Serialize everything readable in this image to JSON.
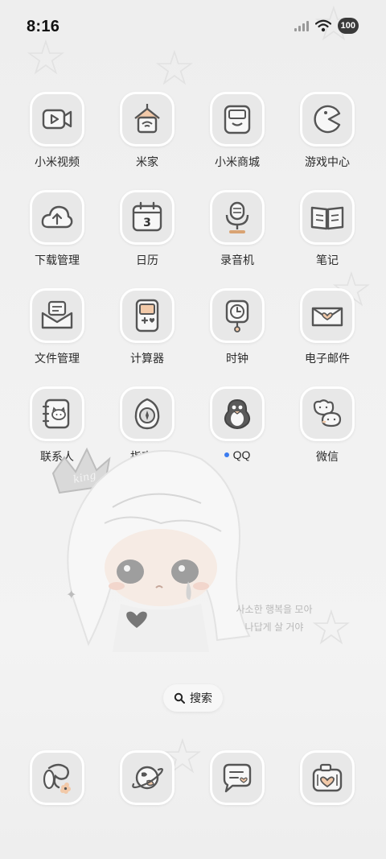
{
  "status_bar": {
    "time": "8:16",
    "battery": "100"
  },
  "apps": [
    {
      "label": "小米视频",
      "icon": "video-camera-icon",
      "name": "xiaomi-video"
    },
    {
      "label": "米家",
      "icon": "smart-home-icon",
      "name": "mijia"
    },
    {
      "label": "小米商城",
      "icon": "shopping-bag-icon",
      "name": "xiaomi-mall"
    },
    {
      "label": "游戏中心",
      "icon": "pacman-icon",
      "name": "game-center"
    },
    {
      "label": "下载管理",
      "icon": "cloud-download-icon",
      "name": "download-manager"
    },
    {
      "label": "日历",
      "icon": "calendar-icon",
      "name": "calendar"
    },
    {
      "label": "录音机",
      "icon": "microphone-icon",
      "name": "recorder"
    },
    {
      "label": "笔记",
      "icon": "notebook-icon",
      "name": "notes"
    },
    {
      "label": "文件管理",
      "icon": "envelope-file-icon",
      "name": "file-manager"
    },
    {
      "label": "计算器",
      "icon": "game-console-icon",
      "name": "calculator"
    },
    {
      "label": "时钟",
      "icon": "clock-icon",
      "name": "clock"
    },
    {
      "label": "电子邮件",
      "icon": "heart-letter-icon",
      "name": "email"
    },
    {
      "label": "联系人",
      "icon": "contact-book-icon",
      "name": "contacts"
    },
    {
      "label": "指南针",
      "icon": "compass-egg-icon",
      "name": "compass"
    },
    {
      "label": "QQ",
      "icon": "penguin-icon",
      "name": "qq",
      "new_dot": true
    },
    {
      "label": "微信",
      "icon": "chat-bubbles-icon",
      "name": "wechat"
    }
  ],
  "calendar_day": "3",
  "wallpaper": {
    "crown_text": "king",
    "caption_line1": "사소한 행복을 모아",
    "caption_line2": "나답게 살 거야"
  },
  "search": {
    "label": "搜索",
    "icon": "search-icon"
  },
  "dock": [
    {
      "icon": "dog-flower-icon",
      "name": "phone"
    },
    {
      "icon": "planet-icon",
      "name": "browser"
    },
    {
      "icon": "message-bubble-icon",
      "name": "messages"
    },
    {
      "icon": "camera-heart-icon",
      "name": "camera"
    }
  ],
  "colors": {
    "background": "#eeeeee",
    "tile": "#e8e8e8",
    "tile_border": "#ffffff",
    "qq_dot": "#3b7cf0",
    "accent_peach": "#f2c9a8"
  }
}
